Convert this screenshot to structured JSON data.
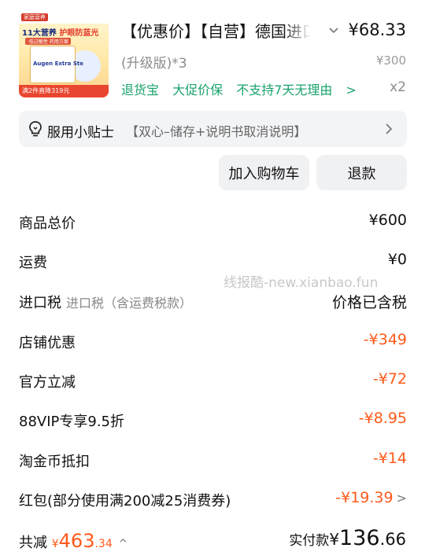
{
  "product": {
    "thumb": {
      "tag": "家庭营养",
      "headline_a": "11大营养",
      "headline_b": "护眼防蓝光",
      "subline": "·低过敏性 药用方案",
      "box_text": "Augen Extra Ste",
      "promo": "满2件直降319元"
    },
    "title": "【优惠价】【自营】德国进口",
    "price": "¥68.33",
    "spec": "(升级版)*3",
    "original_price": "¥300",
    "tags": [
      "退货宝",
      "大促价保",
      "不支持7天无理由"
    ],
    "tags_arrow": ">",
    "quantity": "x2"
  },
  "tip": {
    "label": "服用小贴士",
    "text": "【双心–储存+说明书取消说明】",
    "icon": "lightbulb-icon"
  },
  "actions": {
    "add_to_cart": "加入购物车",
    "refund": "退款"
  },
  "summary": {
    "rows": [
      {
        "label": "商品总价",
        "value": "¥600"
      },
      {
        "label": "运费",
        "value": "¥0"
      },
      {
        "label": "进口税",
        "sub": "进口税（含运费税款）",
        "value": "价格已含税"
      },
      {
        "label": "店铺优惠",
        "value": "-¥349"
      },
      {
        "label": "官方立减",
        "value": "-¥72"
      },
      {
        "label": "88VIP专享9.5折",
        "value": "-¥8.95"
      },
      {
        "label": "淘金币抵扣",
        "value": "-¥14"
      },
      {
        "label": "红包(部分使用满200减25消费券)",
        "value": "-¥19.39",
        "chevron": ">"
      }
    ]
  },
  "watermark": "线报酷-new.xianbao.fun",
  "footer": {
    "saved_label": "共减",
    "saved_currency": "¥",
    "saved_int": "463",
    "saved_dec": ".34",
    "saved_caret": "^",
    "paid_label": "实付款",
    "paid_currency": "¥",
    "paid_int": "136",
    "paid_dec": ".66"
  },
  "colors": {
    "discount": "#ff5a1a",
    "service_tags": "#1aa36b",
    "muted": "#8b8b8b",
    "panel": "#f3f4f6"
  }
}
